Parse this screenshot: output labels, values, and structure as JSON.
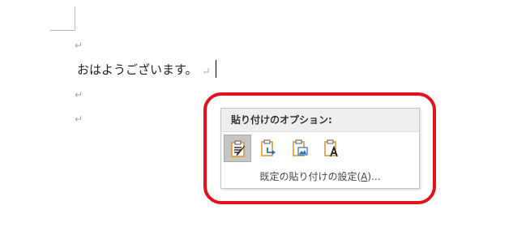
{
  "document": {
    "paragraph_mark": "↵",
    "line_text": "おはようございます。"
  },
  "paste_options": {
    "header": "貼り付けのオプション:",
    "buttons": [
      {
        "name": "keep-source-formatting",
        "icon": "clipboard-brush-icon",
        "selected": true
      },
      {
        "name": "merge-formatting",
        "icon": "clipboard-arrow-icon",
        "selected": false
      },
      {
        "name": "picture",
        "icon": "clipboard-picture-icon",
        "selected": false
      },
      {
        "name": "keep-text-only",
        "icon": "clipboard-text-icon",
        "selected": false
      }
    ],
    "set_default_link": {
      "before": "既定の貼り付けの設定(",
      "accel": "A",
      "after": ")..."
    }
  },
  "colors": {
    "highlight_ring": "#e2121e",
    "clipboard_orange": "#d99a3a",
    "arrow_blue": "#2f6fb3"
  }
}
